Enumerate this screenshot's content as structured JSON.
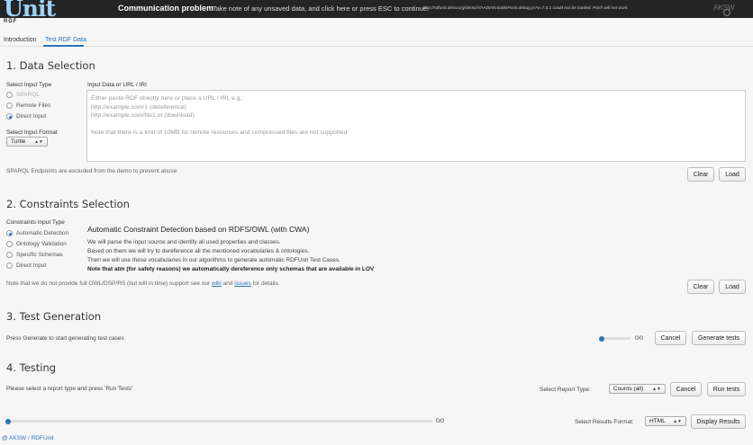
{
  "notification": {
    "logo": "Unit",
    "logo_sub": "RDF",
    "title": "Communication problem",
    "message": "Take note of any unsaved data, and click here or press ESC to continue.",
    "detail": "http://rdfunit.aksw.org/demo/VAADIN/vaadinPush.debug.js?v=7.6.1 could not be loaded. Push will not work.",
    "brand": "AKSW"
  },
  "tabs": [
    "Introduction",
    "Test RDF Data"
  ],
  "data_selection": {
    "heading": "1. Data Selection",
    "input_type_label": "Select Input Type",
    "input_types": [
      "SPARQL",
      "Remote Files",
      "Direct Input"
    ],
    "format_label": "Select Input Format",
    "format_value": "Turtle",
    "input_label": "Input Data or URL / IRI",
    "placeholder": "Either paste RDF directly here or place a URL / IRI, e.g.:\nhttp://example.com/1 (dereference)\nhttp://example.com/file1.nt (download)\n\nNote that there is a limit of 10MB for remote resources and compressed files are not supported",
    "note": "SPARQL Endpoints are excluded from the demo to prevent abuse",
    "clear": "Clear",
    "load": "Load"
  },
  "constraints": {
    "heading": "2. Constraints Selection",
    "type_label": "Constraints Input Type",
    "types": [
      "Automatic Detection",
      "Ontology Validation",
      "Specific Schemas",
      "Direct Input"
    ],
    "title": "Automatic Constraint Detection based on RDFS/OWL (with CWA)",
    "lines": [
      "We will parse the input source and identify all used properties and classes.",
      "Based on them we will try to dereference all the mentioned vocabularies & ontologies.",
      "Then we will use these vocabularies in our algorithms to generate automatic RDFUnit Test Cases."
    ],
    "bold_line": "Note that atm (for safety reasons) we automatically dereference only schemas that are available in LOV",
    "footnote_pre": "Note that we do not provide full OWL/DSP/RS (but will in time) support see our",
    "wiki": "wiki",
    "and": "and",
    "issues": "issues",
    "footnote_post": "for details.",
    "clear": "Clear",
    "load": "Load"
  },
  "generation": {
    "heading": "3. Test Generation",
    "text": "Press Generate to start generating test cases",
    "progress_text": "0/0",
    "progress": 0,
    "cancel": "Cancel",
    "generate": "Generate tests"
  },
  "testing": {
    "heading": "4. Testing",
    "text": "Please select a report type and press 'Run Tests'",
    "report_label": "Select Report Type:",
    "report_value": "Counts (all)",
    "cancel": "Cancel",
    "run": "Run tests",
    "progress_text": "0/0",
    "progress": 0,
    "format_label": "Select Results Format:",
    "format_value": "HTML",
    "display": "Display Results"
  },
  "footer": "@ AKSW / RDFUnit",
  "colors": {
    "accent": "#2a74b8",
    "topbar": "#242424"
  }
}
